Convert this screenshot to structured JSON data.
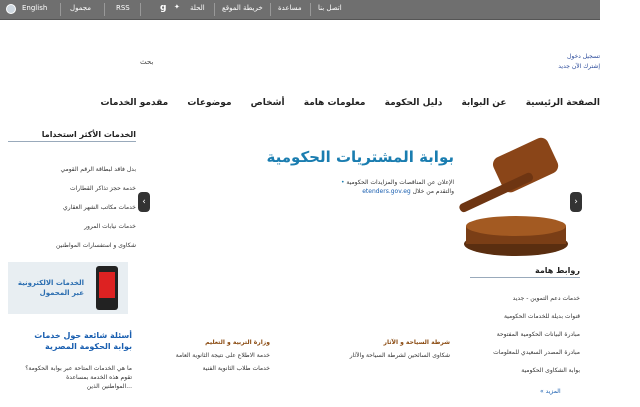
{
  "topbar": {
    "items": [
      "اتصل بنا",
      "مساعدة",
      "خريطة الموقع",
      "الحلة",
      "RSS",
      "مجمول",
      "English"
    ]
  },
  "login": {
    "signin": "تسجيل دخول",
    "register": "إشترك الآن جديد"
  },
  "search": {
    "label": "بحث"
  },
  "nav": {
    "items": [
      "الصفحة الرئيسية",
      "عن البوابة",
      "دليل الحكومة",
      "معلومات هامة",
      "أشخاص",
      "موضوعات",
      "مقدمو الخدمات"
    ]
  },
  "banner": {
    "title": "بوابة المشتريات الحكومية",
    "line1": "الإعلان عن المناقصات والمزايدات الحكومية",
    "line2": "والتقدم من خلال",
    "url": "etenders.gov.eg"
  },
  "aside": {
    "title": "الخدمات الأكثر استخداما",
    "items": [
      "بدل فاقد لبطاقة الرقم القومي",
      "خدمة حجز تذاكر القطارات",
      "خدمات مكاتب الشهر العقاري",
      "خدمات نيابات المرور",
      "شكاوى و استفسارات المواطنين"
    ]
  },
  "mobile": {
    "line1": "الخدمات الالكترونية",
    "line2": "عبر المحمول"
  },
  "faq": {
    "title_line1": "أسئلة شائعة حول خدمات",
    "title_line2": "بوابة الحكومة المصرية",
    "items": [
      "ما هي الخدمات المتاحة عبر بوابة الحكومة؟",
      "تقوم هذه الخدمة بمساعدة",
      "المواطنين الذين..."
    ]
  },
  "tourism": {
    "title": "شرطة السياحة و الآثار",
    "items": [
      "شكاوى السائحين لشرطة السياحة والآثار"
    ]
  },
  "education": {
    "title": "وزارة التربية و التعليم",
    "items": [
      "خدمة الاطلاع على نتيجة الثانوية العامة",
      "خدمات طلاب الثانوية الفنية"
    ]
  },
  "links": {
    "title": "روابط هامة",
    "items": [
      "خدمات دعم التموين - جديد",
      "قنوات بديلة للخدمات الحكومية",
      "مبادرة البيانات الحكومية المفتوحة",
      "مبادرة المصدر السعيدي للمعلومات",
      "بوابة الشكاوى الحكومية"
    ],
    "more": "المزيد"
  }
}
